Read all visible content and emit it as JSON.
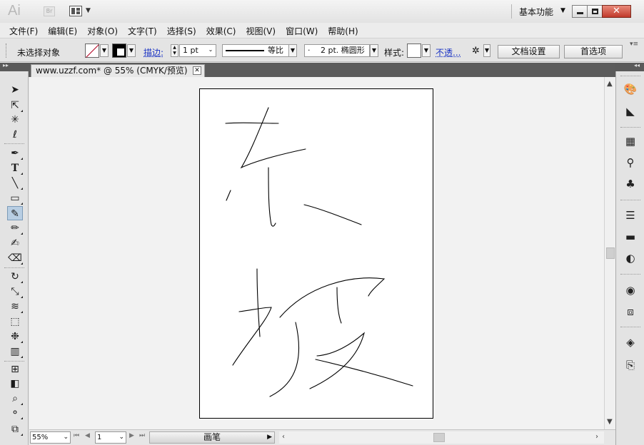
{
  "titlebar": {
    "app_logo": "Ai",
    "bridge": "Br",
    "workspace": "基本功能",
    "close_glyph": "✕"
  },
  "menu": [
    "文件(F)",
    "编辑(E)",
    "对象(O)",
    "文字(T)",
    "选择(S)",
    "效果(C)",
    "视图(V)",
    "窗口(W)",
    "帮助(H)"
  ],
  "control": {
    "selection_status": "未选择对象",
    "stroke_label": "描边:",
    "stroke_weight": "1 pt",
    "profile": "等比",
    "brush_dot": "·",
    "brush": "2 pt. 椭圆形",
    "style_label": "样式:",
    "opacity_link": "不透...",
    "doc_setup": "文档设置",
    "preferences": "首选项"
  },
  "document": {
    "tab_title": "www.uzzf.com* @ 55% (CMYK/预览)",
    "close_glyph": "✕"
  },
  "status": {
    "zoom": "55%",
    "page": "1",
    "current_tool": "画笔"
  },
  "icons": {
    "tools": [
      "selection-icon",
      "direct-selection-icon",
      "magic-wand-icon",
      "lasso-icon",
      "pen-icon",
      "type-icon",
      "line-segment-icon",
      "rectangle-icon",
      "paintbrush-icon",
      "pencil-icon",
      "blob-brush-icon",
      "eraser-icon",
      "rotate-icon",
      "scale-icon",
      "warp-icon",
      "free-transform-icon",
      "symbol-sprayer-icon",
      "column-graph-icon",
      "mesh-icon",
      "gradient-icon",
      "eyedropper-icon",
      "blend-icon",
      "live-paint-icon"
    ],
    "dock": [
      "color-icon",
      "color-guide-icon",
      "swatches-icon",
      "brushes-icon",
      "symbols-icon",
      "stroke-icon",
      "gradient-panel-icon",
      "transparency-icon",
      "appearance-icon",
      "graphic-styles-icon",
      "layers-icon",
      "artboards-icon"
    ]
  },
  "colors": {
    "active_tool": "#b8cee3",
    "panel_strip": "#5a5a5a"
  }
}
